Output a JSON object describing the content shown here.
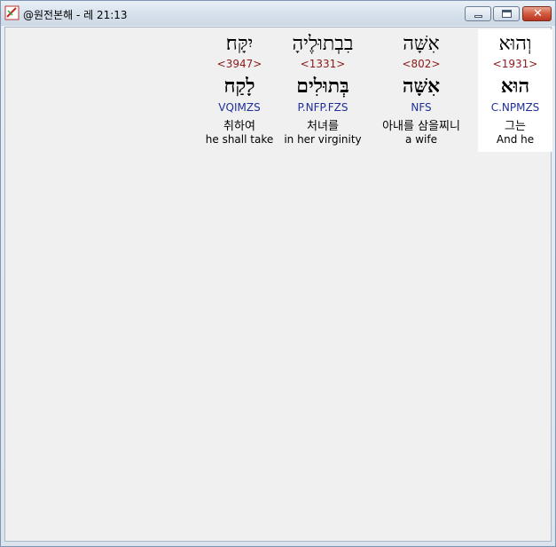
{
  "window": {
    "title": "@원전본해 - 레 21:13",
    "controls": {
      "minimize_icon": "minimize-icon",
      "maximize_icon": "maximize-icon",
      "close_icon": "close-icon",
      "close_glyph": "✕"
    }
  },
  "interlinear": [
    {
      "hebrew": "וְהוּא",
      "strong": "<1931>",
      "lemma": "הוּא",
      "parsing": "C.NPMZS",
      "korean": "그는",
      "english": "And he"
    },
    {
      "hebrew": "אִשָּׁה",
      "strong": "<802>",
      "lemma": "אִשָּׁה",
      "parsing": "NFS",
      "korean": "아내를 삼을찌니",
      "english": "a wife"
    },
    {
      "hebrew": "בִבְתוּלֶיהָ",
      "strong": "<1331>",
      "lemma": "בְּתוּלִים",
      "parsing": "P.NFP.FZS",
      "korean": "처녀를",
      "english": "in her virginity"
    },
    {
      "hebrew": "יִקָּח׃",
      "strong": "<3947>",
      "lemma": "לָקַח",
      "parsing": "VQIMZS",
      "korean": "취하여",
      "english": "he shall take"
    }
  ]
}
